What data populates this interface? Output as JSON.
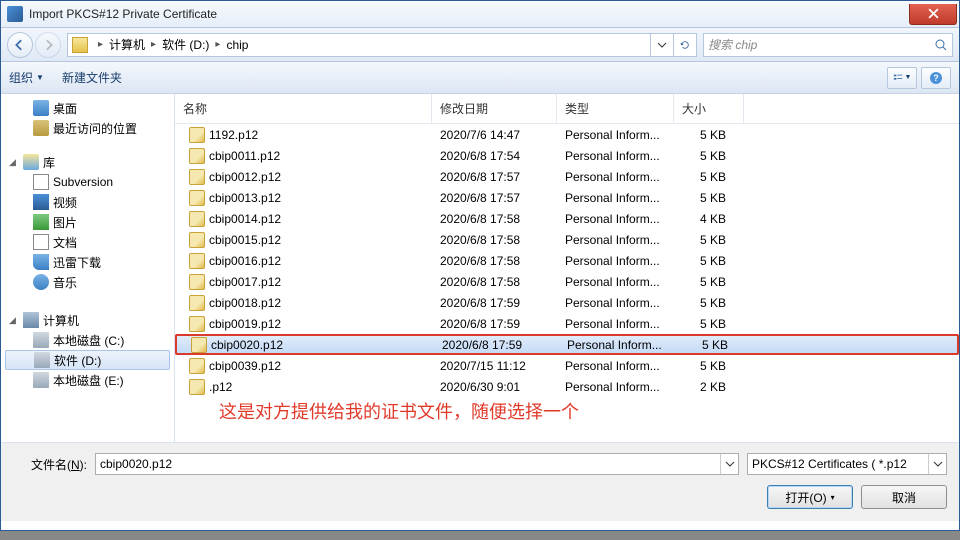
{
  "window_title": "Import PKCS#12 Private Certificate",
  "breadcrumb": {
    "root": "计算机",
    "drive": "软件 (D:)",
    "folder": "chip"
  },
  "search_placeholder": "搜索 chip",
  "toolbar": {
    "organize": "组织",
    "newfolder": "新建文件夹"
  },
  "columns": {
    "name": "名称",
    "date": "修改日期",
    "type": "类型",
    "size": "大小"
  },
  "sidebar": {
    "desktop": "桌面",
    "recent": "最近访问的位置",
    "libs": "库",
    "subversion": "Subversion",
    "video": "视频",
    "pictures": "图片",
    "docs": "文档",
    "xunlei": "迅雷下载",
    "music": "音乐",
    "computer": "计算机",
    "drive_c": "本地磁盘 (C:)",
    "drive_d": "软件 (D:)",
    "drive_e": "本地磁盘 (E:)"
  },
  "files": [
    {
      "name": "1192.p12",
      "date": "2020/7/6 14:47",
      "type": "Personal Inform...",
      "size": "5 KB"
    },
    {
      "name": "cbip0011.p12",
      "date": "2020/6/8 17:54",
      "type": "Personal Inform...",
      "size": "5 KB"
    },
    {
      "name": "cbip0012.p12",
      "date": "2020/6/8 17:57",
      "type": "Personal Inform...",
      "size": "5 KB"
    },
    {
      "name": "cbip0013.p12",
      "date": "2020/6/8 17:57",
      "type": "Personal Inform...",
      "size": "5 KB"
    },
    {
      "name": "cbip0014.p12",
      "date": "2020/6/8 17:58",
      "type": "Personal Inform...",
      "size": "4 KB"
    },
    {
      "name": "cbip0015.p12",
      "date": "2020/6/8 17:58",
      "type": "Personal Inform...",
      "size": "5 KB"
    },
    {
      "name": "cbip0016.p12",
      "date": "2020/6/8 17:58",
      "type": "Personal Inform...",
      "size": "5 KB"
    },
    {
      "name": "cbip0017.p12",
      "date": "2020/6/8 17:58",
      "type": "Personal Inform...",
      "size": "5 KB"
    },
    {
      "name": "cbip0018.p12",
      "date": "2020/6/8 17:59",
      "type": "Personal Inform...",
      "size": "5 KB"
    },
    {
      "name": "cbip0019.p12",
      "date": "2020/6/8 17:59",
      "type": "Personal Inform...",
      "size": "5 KB"
    },
    {
      "name": "cbip0020.p12",
      "date": "2020/6/8 17:59",
      "type": "Personal Inform...",
      "size": "5 KB"
    },
    {
      "name": "cbip0039.p12",
      "date": "2020/7/15 11:12",
      "type": "Personal Inform...",
      "size": "5 KB"
    },
    {
      "name": ".p12",
      "date": "2020/6/30 9:01",
      "type": "Personal Inform...",
      "size": "2 KB"
    }
  ],
  "selected_index": 10,
  "annotation": "这是对方提供给我的证书文件，随便选择一个",
  "filename_label": "文件名(N):",
  "filename_value": "cbip0020.p12",
  "filter_label": "PKCS#12 Certificates ( *.p12",
  "open_label": "打开(O)",
  "cancel_label": "取消"
}
